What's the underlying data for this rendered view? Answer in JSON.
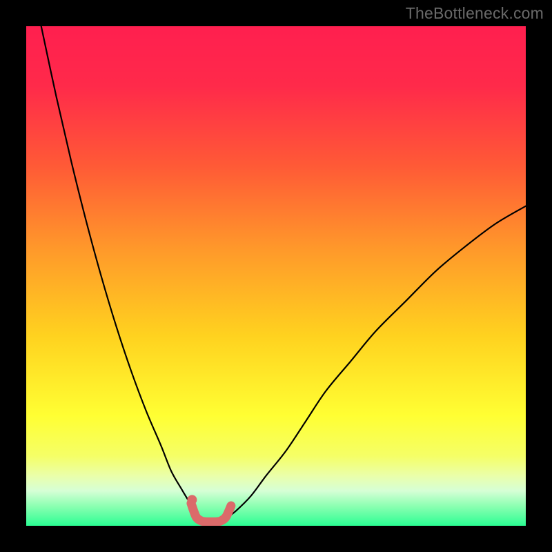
{
  "watermark": "TheBottleneck.com",
  "chart_data": {
    "type": "line",
    "title": "",
    "xlabel": "",
    "ylabel": "",
    "xlim": [
      0,
      100
    ],
    "ylim": [
      0,
      100
    ],
    "grid": false,
    "legend": false,
    "background_gradient": [
      {
        "stop": 0.0,
        "color": "#ff1f4f"
      },
      {
        "stop": 0.12,
        "color": "#ff2a4a"
      },
      {
        "stop": 0.28,
        "color": "#ff5a36"
      },
      {
        "stop": 0.45,
        "color": "#ff9a2a"
      },
      {
        "stop": 0.62,
        "color": "#ffd21f"
      },
      {
        "stop": 0.78,
        "color": "#ffff33"
      },
      {
        "stop": 0.86,
        "color": "#f5ff66"
      },
      {
        "stop": 0.9,
        "color": "#eaffaa"
      },
      {
        "stop": 0.93,
        "color": "#d6ffd6"
      },
      {
        "stop": 0.96,
        "color": "#8dffb2"
      },
      {
        "stop": 1.0,
        "color": "#2bfd93"
      }
    ],
    "series": [
      {
        "name": "left-branch",
        "color": "#000000",
        "x": [
          3,
          6,
          9,
          12,
          15,
          18,
          21,
          24,
          27,
          29,
          31,
          32.5,
          33.5,
          34.3,
          35
        ],
        "y": [
          100,
          86,
          73,
          61,
          50,
          40,
          31,
          23,
          16,
          11,
          7.5,
          5,
          3.5,
          2.3,
          1.5
        ]
      },
      {
        "name": "right-branch",
        "color": "#000000",
        "x": [
          40,
          42,
          45,
          48,
          52,
          56,
          60,
          65,
          70,
          76,
          82,
          88,
          94,
          100
        ],
        "y": [
          1.5,
          3,
          6,
          10,
          15,
          21,
          27,
          33,
          39,
          45,
          51,
          56,
          60.5,
          64
        ]
      },
      {
        "name": "trough-marker",
        "color": "#db6a6a",
        "x": [
          33,
          34,
          35,
          36,
          37,
          38,
          39,
          40,
          41
        ],
        "y": [
          4.5,
          1.8,
          1.0,
          0.8,
          0.8,
          0.8,
          1.0,
          1.8,
          4.0
        ]
      }
    ],
    "annotations": [
      {
        "name": "trough-start-dot",
        "x": 33.2,
        "y": 5.2,
        "color": "#db6a6a"
      }
    ]
  }
}
